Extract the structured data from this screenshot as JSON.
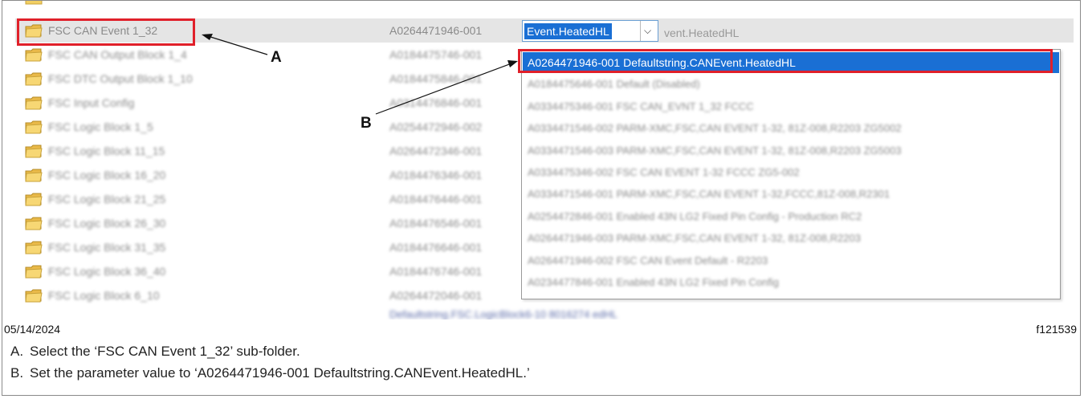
{
  "rows": [
    {
      "name": "FSC CAN Event 1_32",
      "part": "A0264471946-001",
      "selected": true
    },
    {
      "name": "FSC CAN Output Block 1_4",
      "part": "A0184475746-001"
    },
    {
      "name": "FSC DTC Output Block 1_10",
      "part": "A0184475846-001"
    },
    {
      "name": "FSC Input Config",
      "part": "A0314476846-001"
    },
    {
      "name": "FSC Logic Block 1_5",
      "part": "A0254472946-002"
    },
    {
      "name": "FSC Logic Block 11_15",
      "part": "A0264472346-001"
    },
    {
      "name": "FSC Logic Block 16_20",
      "part": "A0184476346-001"
    },
    {
      "name": "FSC Logic Block 21_25",
      "part": "A0184476446-001"
    },
    {
      "name": "FSC Logic Block 26_30",
      "part": "A0184476546-001"
    },
    {
      "name": "FSC Logic Block 31_35",
      "part": "A0184476646-001"
    },
    {
      "name": "FSC Logic Block 36_40",
      "part": "A0184476746-001"
    },
    {
      "name": "FSC Logic Block 6_10",
      "part": "A0264472046-001"
    }
  ],
  "combo": {
    "value": "Event.HeatedHL",
    "ghost": "vent.HeatedHL",
    "chevron": "chevron-down-icon"
  },
  "dropdown": {
    "options": [
      "A0264471946-001 Defaultstring.CANEvent.HeatedHL",
      "A0184475646-001 Default (Disabled)",
      "A0334475346-001 FSC CAN_EVNT 1_32 FCCC",
      "A0334471546-002 PARM-XMC,FSC,CAN EVENT 1-32, 81Z-008,R2203 ZG5002",
      "A0334471546-003 PARM-XMC,FSC,CAN EVENT 1-32, 81Z-008,R2203 ZG5003",
      "A0334475346-002 FSC CAN EVENT 1-32 FCCC ZG5-002",
      "A0334471546-001 PARM-XMC,FSC,CAN EVENT 1-32,FCCC,81Z-008,R2301",
      "A0254472846-001 Enabled 43N LG2 Fixed Pin Config - Production RC2",
      "A0264471946-003 PARM-XMC,FSC,CAN EVENT 1-32, 81Z-008,R2203",
      "A0264471946-002 FSC CAN Event Default - R2203",
      "A0234477846-001 Enabled 43N LG2 Fixed Pin Config"
    ],
    "highlighted_index": 0
  },
  "partial_row_value": "Defaultstring.FSC.LogicBlock6-10 8016274   edHL",
  "callouts": {
    "a": "A",
    "b": "B"
  },
  "date": "05/14/2024",
  "figure_id": "f121539",
  "captions": [
    {
      "letter": "A.",
      "text": "Select the ‘FSC CAN Event 1_32’ sub-folder."
    },
    {
      "letter": "B.",
      "text": "Set the parameter value to ‘A0264471946-001 Defaultstring.CANEvent.HeatedHL.’"
    }
  ],
  "colors": {
    "highlight": "#1a6fd4",
    "callout_box": "#e0202a",
    "selected_row": "#e5e5e5"
  }
}
